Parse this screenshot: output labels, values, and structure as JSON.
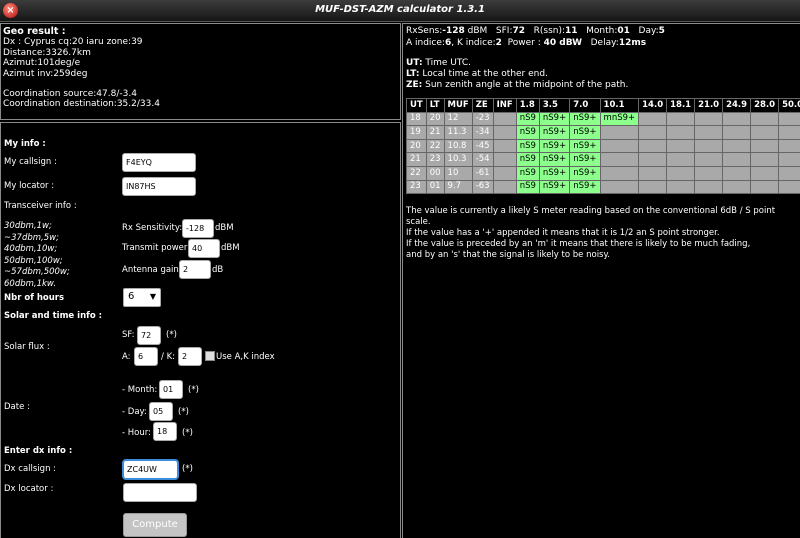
{
  "window": {
    "title": "MUF-DST-AZM calculator 1.3.1",
    "close": "×"
  },
  "geo": {
    "heading": "Geo result :",
    "lines": [
      "Dx : Cyprus cq:20 iaru zone:39",
      "Distance:3326.7km",
      "Azimut:101deg/e",
      "Azimut inv:259deg",
      "",
      "Coordination source:47.8/-3.4",
      "Coordination destination:35.2/33.4"
    ]
  },
  "form": {
    "my_info": "My info :",
    "callsign_label": "My callsign :",
    "callsign_value": "F4EYQ",
    "locator_label": "My locator :",
    "locator_value": "IN87HS",
    "transceiver_label": "Transceiver info :",
    "power_hints": [
      "30dbm,1w;",
      "~37dbm,5w;",
      "40dbm,10w;",
      "50dbm,100w;",
      "~57dbm,500w;",
      "60dbm,1kw."
    ],
    "rx_label": "Rx Sensitivity:",
    "rx_value": "-128",
    "rx_unit": "dBM",
    "tx_label": "Transmit power:",
    "tx_value": "40",
    "tx_unit": "dBM",
    "gain_label": "Antenna gain:",
    "gain_value": "2",
    "gain_unit": "dB",
    "hours_label": "Nbr of hours",
    "hours_value": "6",
    "solar_time_label": "Solar and time info :",
    "solar_flux_label": "Solar flux :",
    "sf_label": "SF:",
    "sf_value": "72",
    "star": "(*)",
    "a_label": "A:",
    "a_value": "6",
    "k_label": "/ K:",
    "k_value": "2",
    "ak_label": "Use A,K index",
    "date_label": "Date :",
    "month_label": "- Month:",
    "month_value": "01",
    "day_label": "- Day:",
    "day_value": "05",
    "hour_label": "- Hour:",
    "hour_value": "18",
    "dx_info": "Enter dx info :",
    "dx_callsign_label": "Dx callsign :",
    "dx_callsign_value": "ZC4UW",
    "dx_locator_label": "Dx locator :",
    "dx_locator_value": "",
    "compute": "Compute"
  },
  "right": {
    "line1": {
      "rxsens_label": "RxSens:",
      "rxsens": "-128",
      "rxsens_unit": "dBM",
      "sfi_label": "SFI:",
      "sfi": "72",
      "rssn_label": "R(ssn):",
      "rssn": "11",
      "month_label": "Month:",
      "month": "01",
      "day_label": "Day:",
      "day": "5"
    },
    "line2": {
      "a_label": "A indice:",
      "a": "6",
      "k_label": ", K indice:",
      "k": "2",
      "power_label": "Power :",
      "power": "40 dBW",
      "delay_label": "Delay:",
      "delay": "12ms"
    },
    "defs": [
      {
        "key": "UT:",
        "text": " Time UTC."
      },
      {
        "key": "LT:",
        "text": " Local time at the other end."
      },
      {
        "key": "ZE:",
        "text": " Sun zenith angle at the midpoint of the path."
      }
    ],
    "table": {
      "headers": [
        "UT",
        "LT",
        "MUF",
        "ZE",
        "INF",
        "1.8",
        "3.5",
        "7.0",
        "10.1",
        "14.0",
        "18.1",
        "21.0",
        "24.9",
        "28.0",
        "50.0"
      ],
      "rows": [
        {
          "ut": "18",
          "lt": "20",
          "muf": "12",
          "ze": "-23",
          "bands": [
            "nS9",
            "nS9+",
            "nS9+",
            "mnS9+",
            "",
            "",
            "",
            "",
            "",
            ""
          ]
        },
        {
          "ut": "19",
          "lt": "21",
          "muf": "11.3",
          "ze": "-34",
          "bands": [
            "nS9",
            "nS9+",
            "nS9+",
            "",
            "",
            "",
            "",
            "",
            "",
            ""
          ]
        },
        {
          "ut": "20",
          "lt": "22",
          "muf": "10.8",
          "ze": "-45",
          "bands": [
            "nS9",
            "nS9+",
            "nS9+",
            "",
            "",
            "",
            "",
            "",
            "",
            ""
          ]
        },
        {
          "ut": "21",
          "lt": "23",
          "muf": "10.3",
          "ze": "-54",
          "bands": [
            "nS9",
            "nS9+",
            "nS9+",
            "",
            "",
            "",
            "",
            "",
            "",
            ""
          ]
        },
        {
          "ut": "22",
          "lt": "00",
          "muf": "10",
          "ze": "-61",
          "bands": [
            "nS9",
            "nS9+",
            "nS9+",
            "",
            "",
            "",
            "",
            "",
            "",
            ""
          ]
        },
        {
          "ut": "23",
          "lt": "01",
          "muf": "9.7",
          "ze": "-63",
          "bands": [
            "nS9",
            "nS9+",
            "nS9+",
            "",
            "",
            "",
            "",
            "",
            "",
            ""
          ]
        }
      ]
    },
    "legend": [
      "The value is currently a likely S meter reading based on the conventional 6dB / S point scale.",
      "If the value has a '+' appended it means that it is 1/2 an S point stronger.",
      "If the value is preceded by an 'm' it means that there is likely to be much fading,",
      "and by an 's' that the signal is likely to be noisy."
    ]
  }
}
